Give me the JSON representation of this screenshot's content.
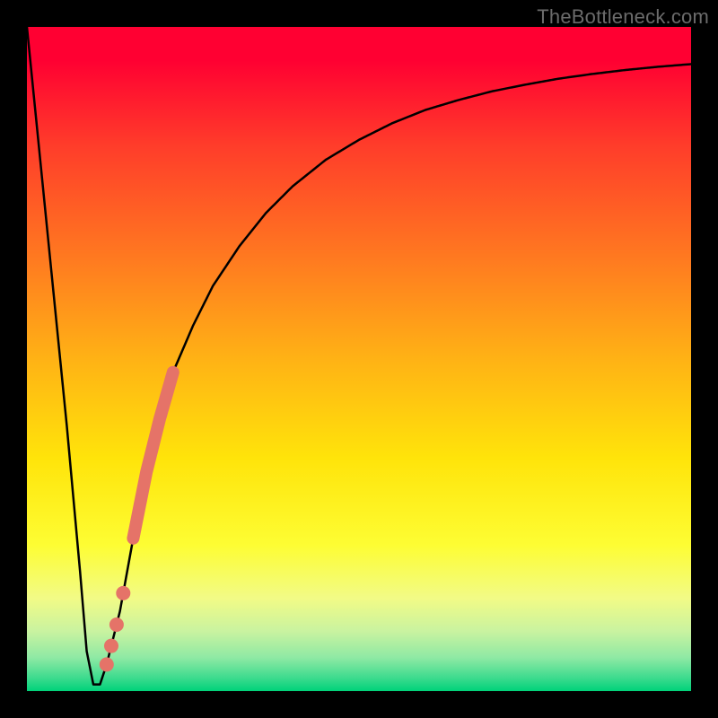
{
  "watermark": "TheBottleneck.com",
  "colors": {
    "frame": "#000000",
    "curve_stroke": "#000000",
    "marker_fill": "#e57368",
    "gradient_top": "#ff0032",
    "gradient_bottom": "#00d27a"
  },
  "chart_data": {
    "type": "line",
    "title": "",
    "xlabel": "",
    "ylabel": "",
    "xlim": [
      0,
      100
    ],
    "ylim": [
      0,
      100
    ],
    "grid": false,
    "legend": false,
    "x": [
      0,
      3,
      6,
      8,
      9,
      10,
      11,
      12,
      14,
      16,
      18,
      20,
      22,
      25,
      28,
      32,
      36,
      40,
      45,
      50,
      55,
      60,
      65,
      70,
      75,
      80,
      85,
      90,
      95,
      100
    ],
    "y": [
      100,
      70,
      40,
      18,
      6,
      1,
      1,
      4,
      12,
      23,
      33,
      41,
      48,
      55,
      61,
      67,
      72,
      76,
      80,
      83,
      85.5,
      87.5,
      89,
      90.3,
      91.3,
      92.2,
      92.9,
      93.5,
      94,
      94.4
    ],
    "annotations": {
      "highlight_segment": {
        "x_from": 16,
        "x_to": 22,
        "style": "thick-line"
      },
      "highlight_points_x": [
        14.5,
        13.5,
        12.7,
        12.0
      ]
    }
  }
}
